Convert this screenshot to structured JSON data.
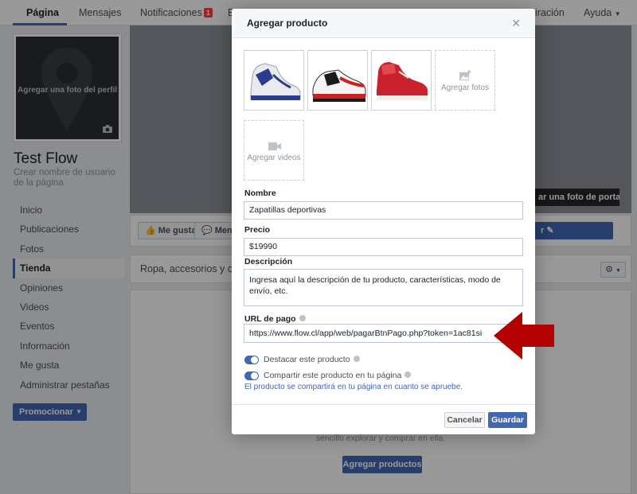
{
  "topnav": {
    "tabs": [
      {
        "label": "Página"
      },
      {
        "label": "Mensajes"
      },
      {
        "label": "Notificaciones"
      },
      {
        "label": "B"
      },
      {
        "label": "iración"
      },
      {
        "label": "Ayuda"
      }
    ],
    "notification_count": "1"
  },
  "profile": {
    "photo_prompt": "Agregar una foto del perfil",
    "page_name": "Test Flow",
    "username_prompt": "Crear nombre de usuario de la página"
  },
  "sidebar": {
    "items": [
      {
        "label": "Inicio"
      },
      {
        "label": "Publicaciones"
      },
      {
        "label": "Fotos"
      },
      {
        "label": "Tienda"
      },
      {
        "label": "Opiniones"
      },
      {
        "label": "Videos"
      },
      {
        "label": "Eventos"
      },
      {
        "label": "Información"
      },
      {
        "label": "Me gusta"
      },
      {
        "label": "Administrar pestañas"
      }
    ],
    "promote_label": "Promocionar"
  },
  "cover": {
    "add_cover_label": "ar una foto de portada"
  },
  "actions": {
    "like_label": "Me gusta",
    "message_label": "Mens",
    "edit_label": "r"
  },
  "store": {
    "categories_text": "Ropa, accesorios y otros",
    "empty_text": "sencillo explorar y comprar en ella.",
    "add_products_label": "Agregar productos"
  },
  "modal": {
    "title": "Agregar producto",
    "add_photos_label": "Agregar fotos",
    "add_videos_label": "Agregar videos",
    "name_label": "Nombre",
    "name_value": "Zapatillas deportivas",
    "price_label": "Precio",
    "price_value": "$19990",
    "description_label": "Descripción",
    "description_value": "Ingresa aquí la descripción de tu producto, características, modo de envío, etc.",
    "url_label": "URL de pago",
    "url_value": "https://www.flow.cl/app/web/pagarBtnPago.php?token=1ac81si",
    "feature_label": "Destacar este producto",
    "share_label": "Compartir este producto en tu página",
    "share_note": "El producto se compartirá en tu página en cuanto se apruebe.",
    "cancel_label": "Cancelar",
    "save_label": "Guardar"
  },
  "colors": {
    "brand_blue": "#4267b2",
    "arrow_red": "#b30000"
  }
}
